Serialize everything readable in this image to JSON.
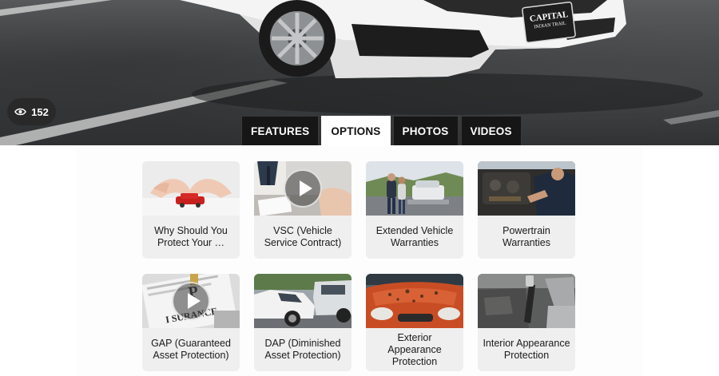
{
  "hero": {
    "plate_line1": "CAPITAL",
    "plate_line2": "INDIAN TRAIL",
    "view_count": "152",
    "view_icon": "eye-icon"
  },
  "tabs": [
    {
      "label": "FEATURES",
      "active": false
    },
    {
      "label": "OPTIONS",
      "active": true
    },
    {
      "label": "PHOTOS",
      "active": false
    },
    {
      "label": "VIDEOS",
      "active": false
    }
  ],
  "cards": [
    {
      "title": "Why Should You Protect Your …",
      "has_video": false
    },
    {
      "title": "VSC (Vehicle Service Contract)",
      "has_video": true
    },
    {
      "title": "Extended Vehicle Warranties",
      "has_video": false
    },
    {
      "title": "Powertrain Warranties",
      "has_video": false
    },
    {
      "title": "GAP (Guaranteed Asset Protection)",
      "has_video": true
    },
    {
      "title": "DAP (Diminished Asset Protection)",
      "has_video": false
    },
    {
      "title": "Exterior Appearance Protection",
      "has_video": false
    },
    {
      "title": "Interior Appearance Protection",
      "has_video": false
    }
  ],
  "colors": {
    "tab_bg": "#161616",
    "tab_active_bg": "#ffffff",
    "card_bg": "#efefef",
    "accent_red": "#c8201e"
  }
}
